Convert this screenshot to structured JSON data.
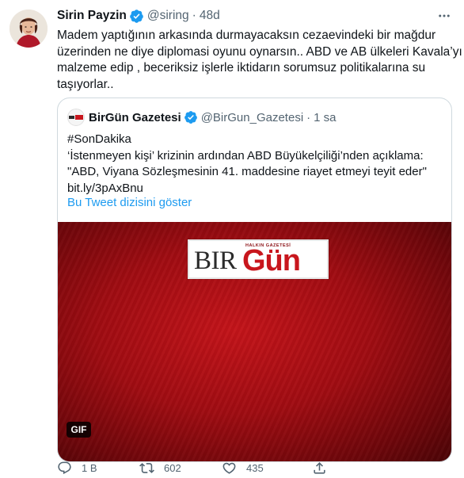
{
  "author": {
    "name": "Sirin Payzin",
    "handle": "@siring",
    "separator": "·",
    "time": "48d"
  },
  "tweet_lines": [
    "Madem yaptığının arkasında durmayacaksın cezaevindeki bir mağdur",
    "üzerinden ne diye diplomasi oyunu oynarsın.. ABD ve AB ülkeleri Kavala’yı",
    "malzeme edip , beceriksiz işlerle iktidarın sorumsuz politikalarına su",
    "taşıyorlar.."
  ],
  "quote": {
    "name": "BirGün Gazetesi",
    "handle": "@BirGun_Gazetesi",
    "separator": "·",
    "time": "1 sa",
    "lines": [
      "#SonDakika",
      "‘İstenmeyen kişi’ krizinin ardından ABD Büyükelçiliği’nden açıklama:",
      "\"ABD, Viyana Sözleşmesinin 41. maddesine riayet etmeyi teyit eder\"",
      "bit.ly/3pAxBnu"
    ],
    "thread_link": "Bu Tweet dizisini göster",
    "media": {
      "logo_small": "HALKIN GAZETESİ",
      "logo_bir": "BIR",
      "logo_gun": "Gün",
      "gif_label": "GIF"
    }
  },
  "actions": {
    "reply_count": "1 B",
    "retweet_count": "602",
    "like_count": "435"
  },
  "colors": {
    "accent": "#1d9bf0",
    "secondary_text": "#536471",
    "brand_red": "#c8161d"
  },
  "icons": [
    "verified-badge-icon",
    "more-icon",
    "reply-icon",
    "retweet-icon",
    "like-icon",
    "share-icon"
  ]
}
